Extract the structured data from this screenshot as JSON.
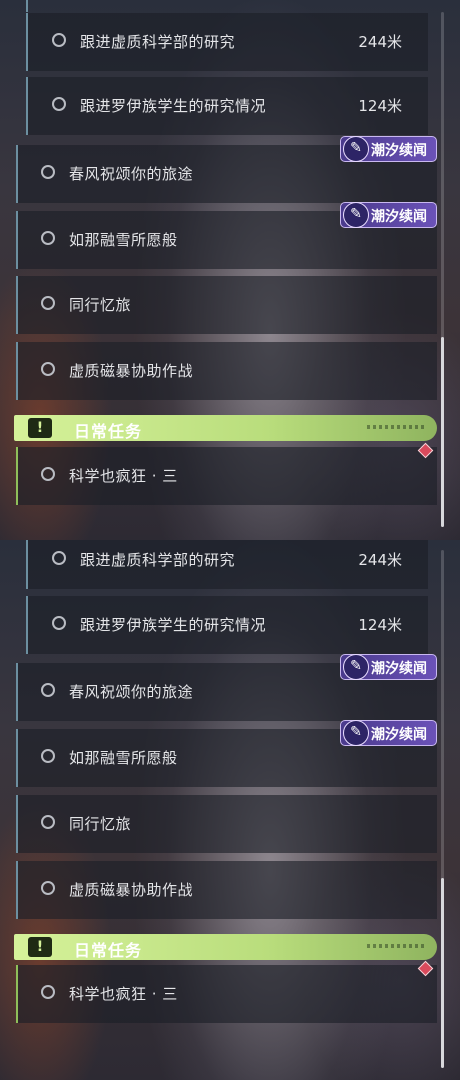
{
  "quests": [
    {
      "label": "跟进虚质科学部的研究",
      "distance": "244米"
    },
    {
      "label": "跟进罗伊族学生的研究情况",
      "distance": "124米"
    },
    {
      "label": "春风祝颂你的旅途",
      "tag": "潮汐续闻"
    },
    {
      "label": "如那融雪所愿般",
      "tag": "潮汐续闻"
    },
    {
      "label": "同行忆旅"
    },
    {
      "label": "虚质磁暴协助作战"
    }
  ],
  "daily": {
    "title": "日常任务",
    "icon_glyph": "!",
    "quest": "科学也疯狂 · 三"
  },
  "tag_icon": "✎",
  "colors": {
    "daily_accent": "#b9dd7c",
    "tag_purple": "#6b52b8",
    "marker_red": "#d94a5c"
  }
}
